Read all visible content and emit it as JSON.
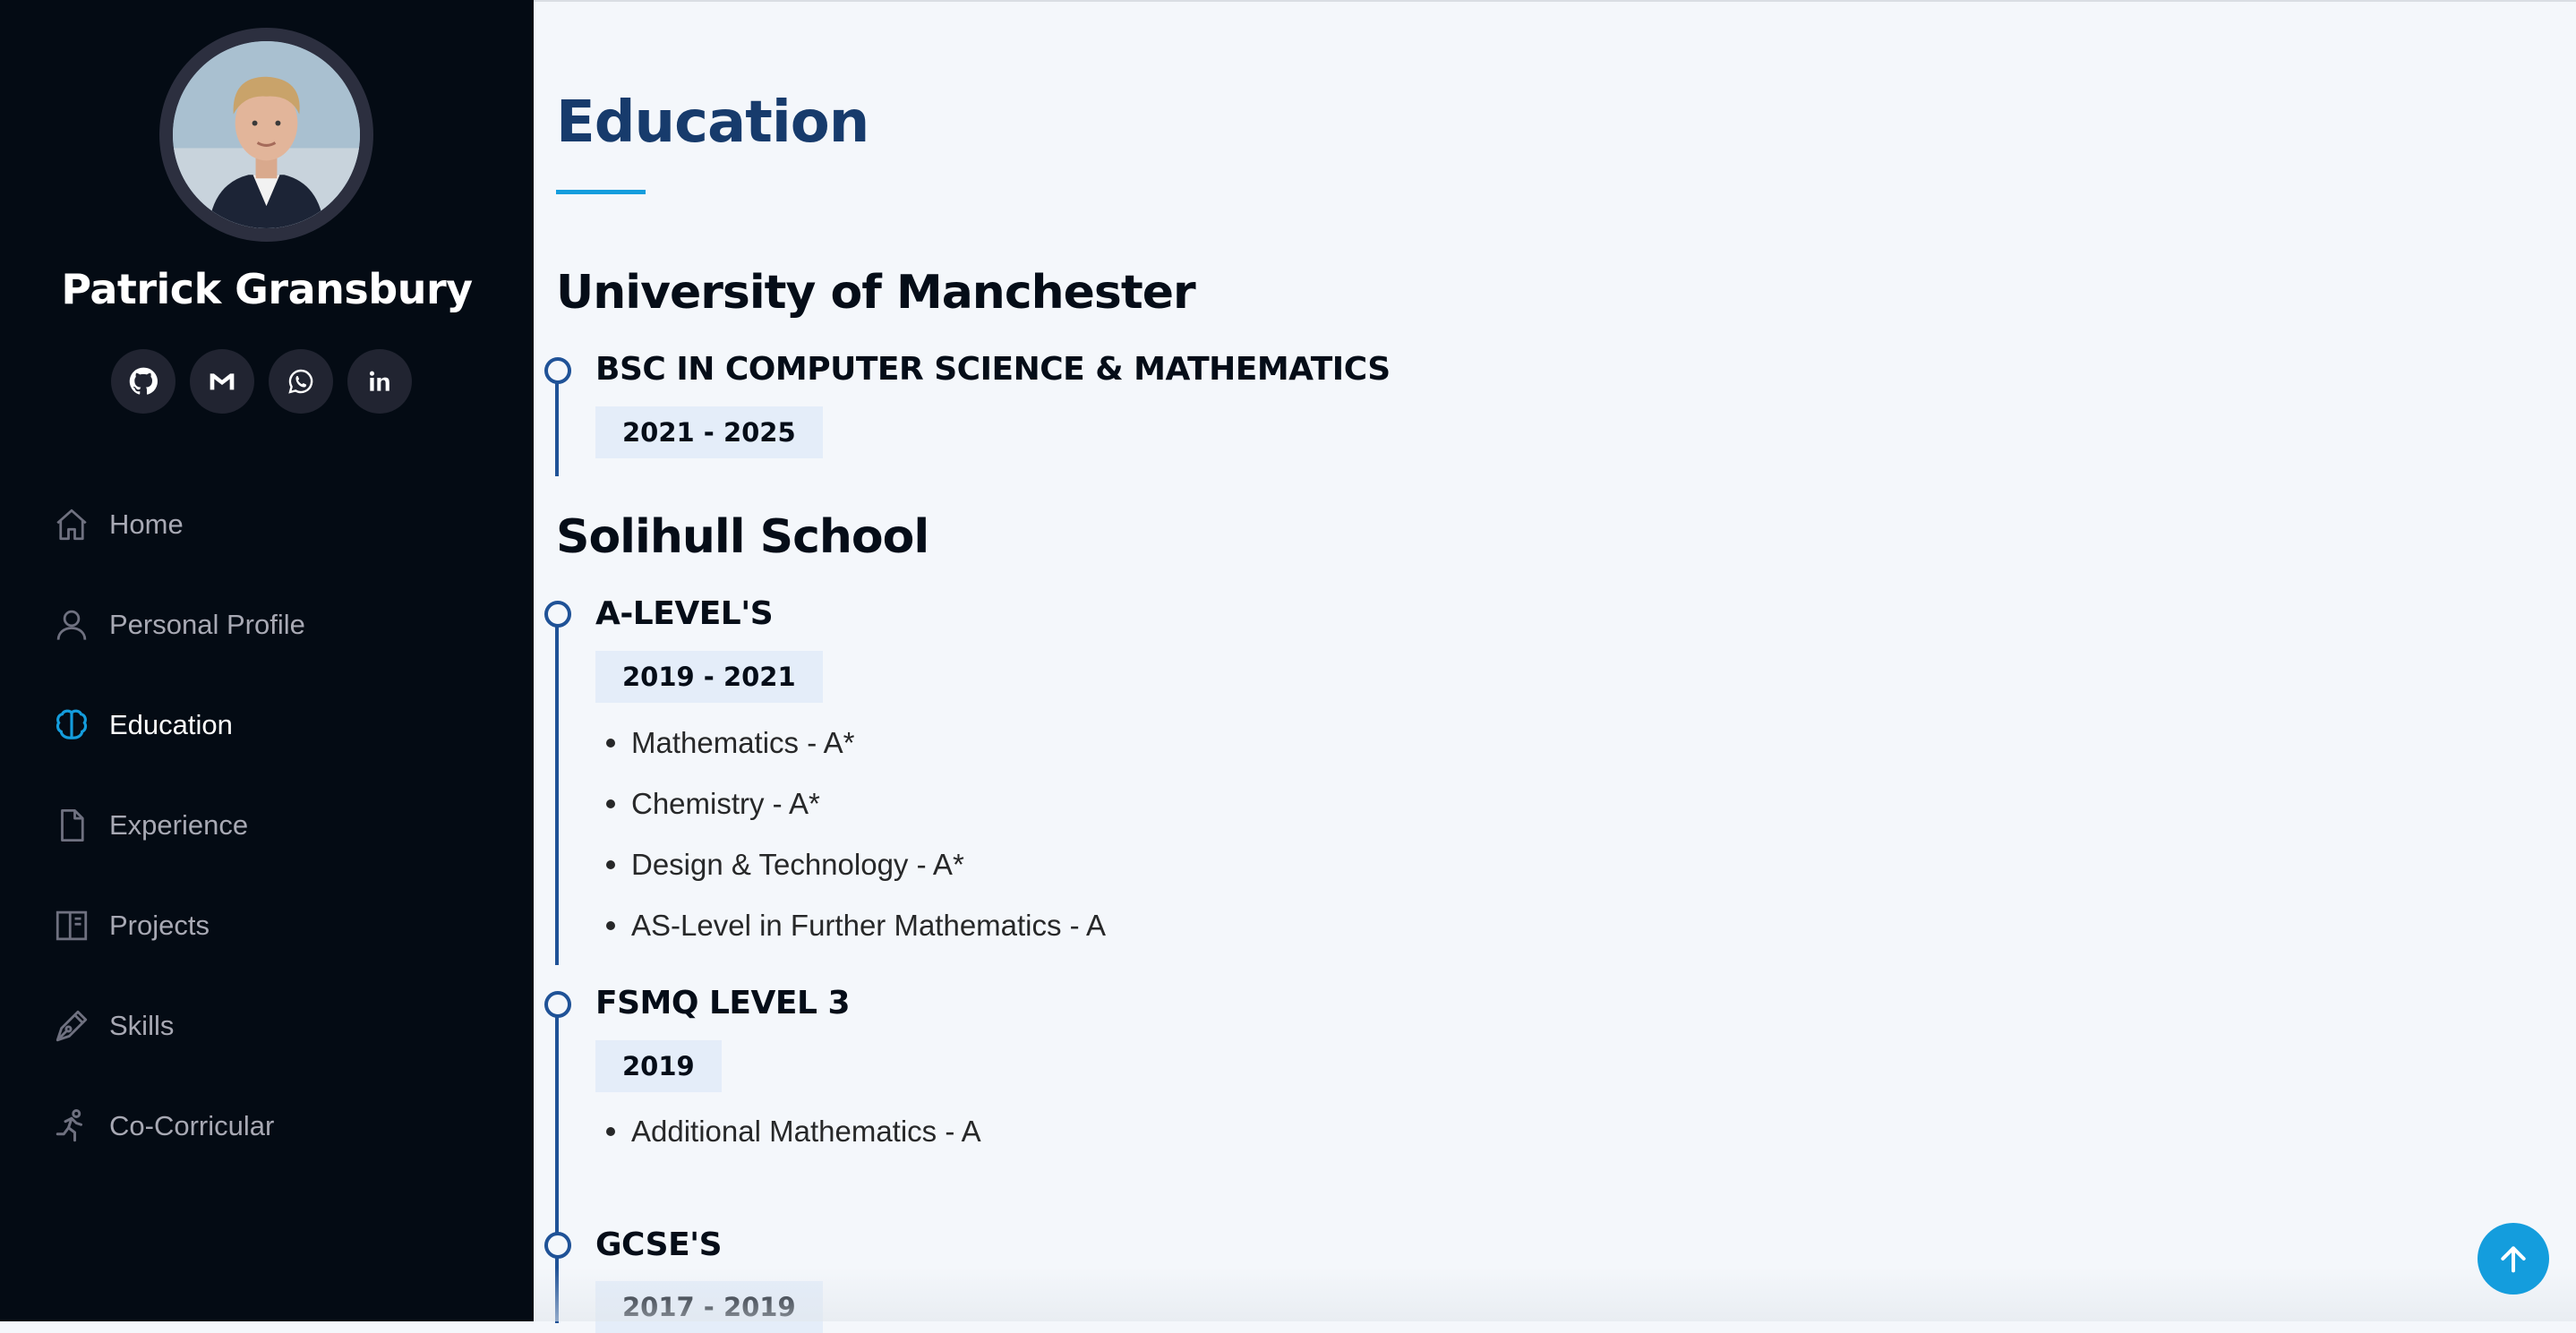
{
  "sidebar": {
    "name": "Patrick Gransbury",
    "social": [
      {
        "icon": "github-icon"
      },
      {
        "icon": "gmail-icon"
      },
      {
        "icon": "whatsapp-icon"
      },
      {
        "icon": "linkedin-icon"
      }
    ],
    "nav": [
      {
        "label": "Home",
        "icon": "home-icon"
      },
      {
        "label": "Personal Profile",
        "icon": "person-icon"
      },
      {
        "label": "Education",
        "icon": "brain-icon",
        "active": true
      },
      {
        "label": "Experience",
        "icon": "file-icon"
      },
      {
        "label": "Projects",
        "icon": "layout-icon"
      },
      {
        "label": "Skills",
        "icon": "pen-icon"
      },
      {
        "label": "Co-Corricular",
        "icon": "runner-icon"
      }
    ]
  },
  "main": {
    "title": "Education",
    "schools": [
      {
        "name": "University of Manchester",
        "qualifications": [
          {
            "title": "BSC IN COMPUTER SCIENCE & MATHEMATICS",
            "dates": "2021 - 2025",
            "grades": []
          }
        ]
      },
      {
        "name": "Solihull School",
        "qualifications": [
          {
            "title": "A-LEVEL'S",
            "dates": "2019 - 2021",
            "grades": [
              "Mathematics - A*",
              "Chemistry - A*",
              "Design & Technology - A*",
              "AS-Level in Further Mathematics - A"
            ]
          },
          {
            "title": "FSMQ LEVEL 3",
            "dates": "2019",
            "grades": [
              "Additional Mathematics - A"
            ]
          },
          {
            "title": "GCSE'S",
            "dates": "2017 - 2019",
            "grades": []
          }
        ]
      }
    ]
  },
  "colors": {
    "sidebar_bg": "#040b14",
    "accent": "#149ddd",
    "heading": "#173b6c",
    "timeline": "#1f5297",
    "badge_bg": "#e4edf9"
  }
}
